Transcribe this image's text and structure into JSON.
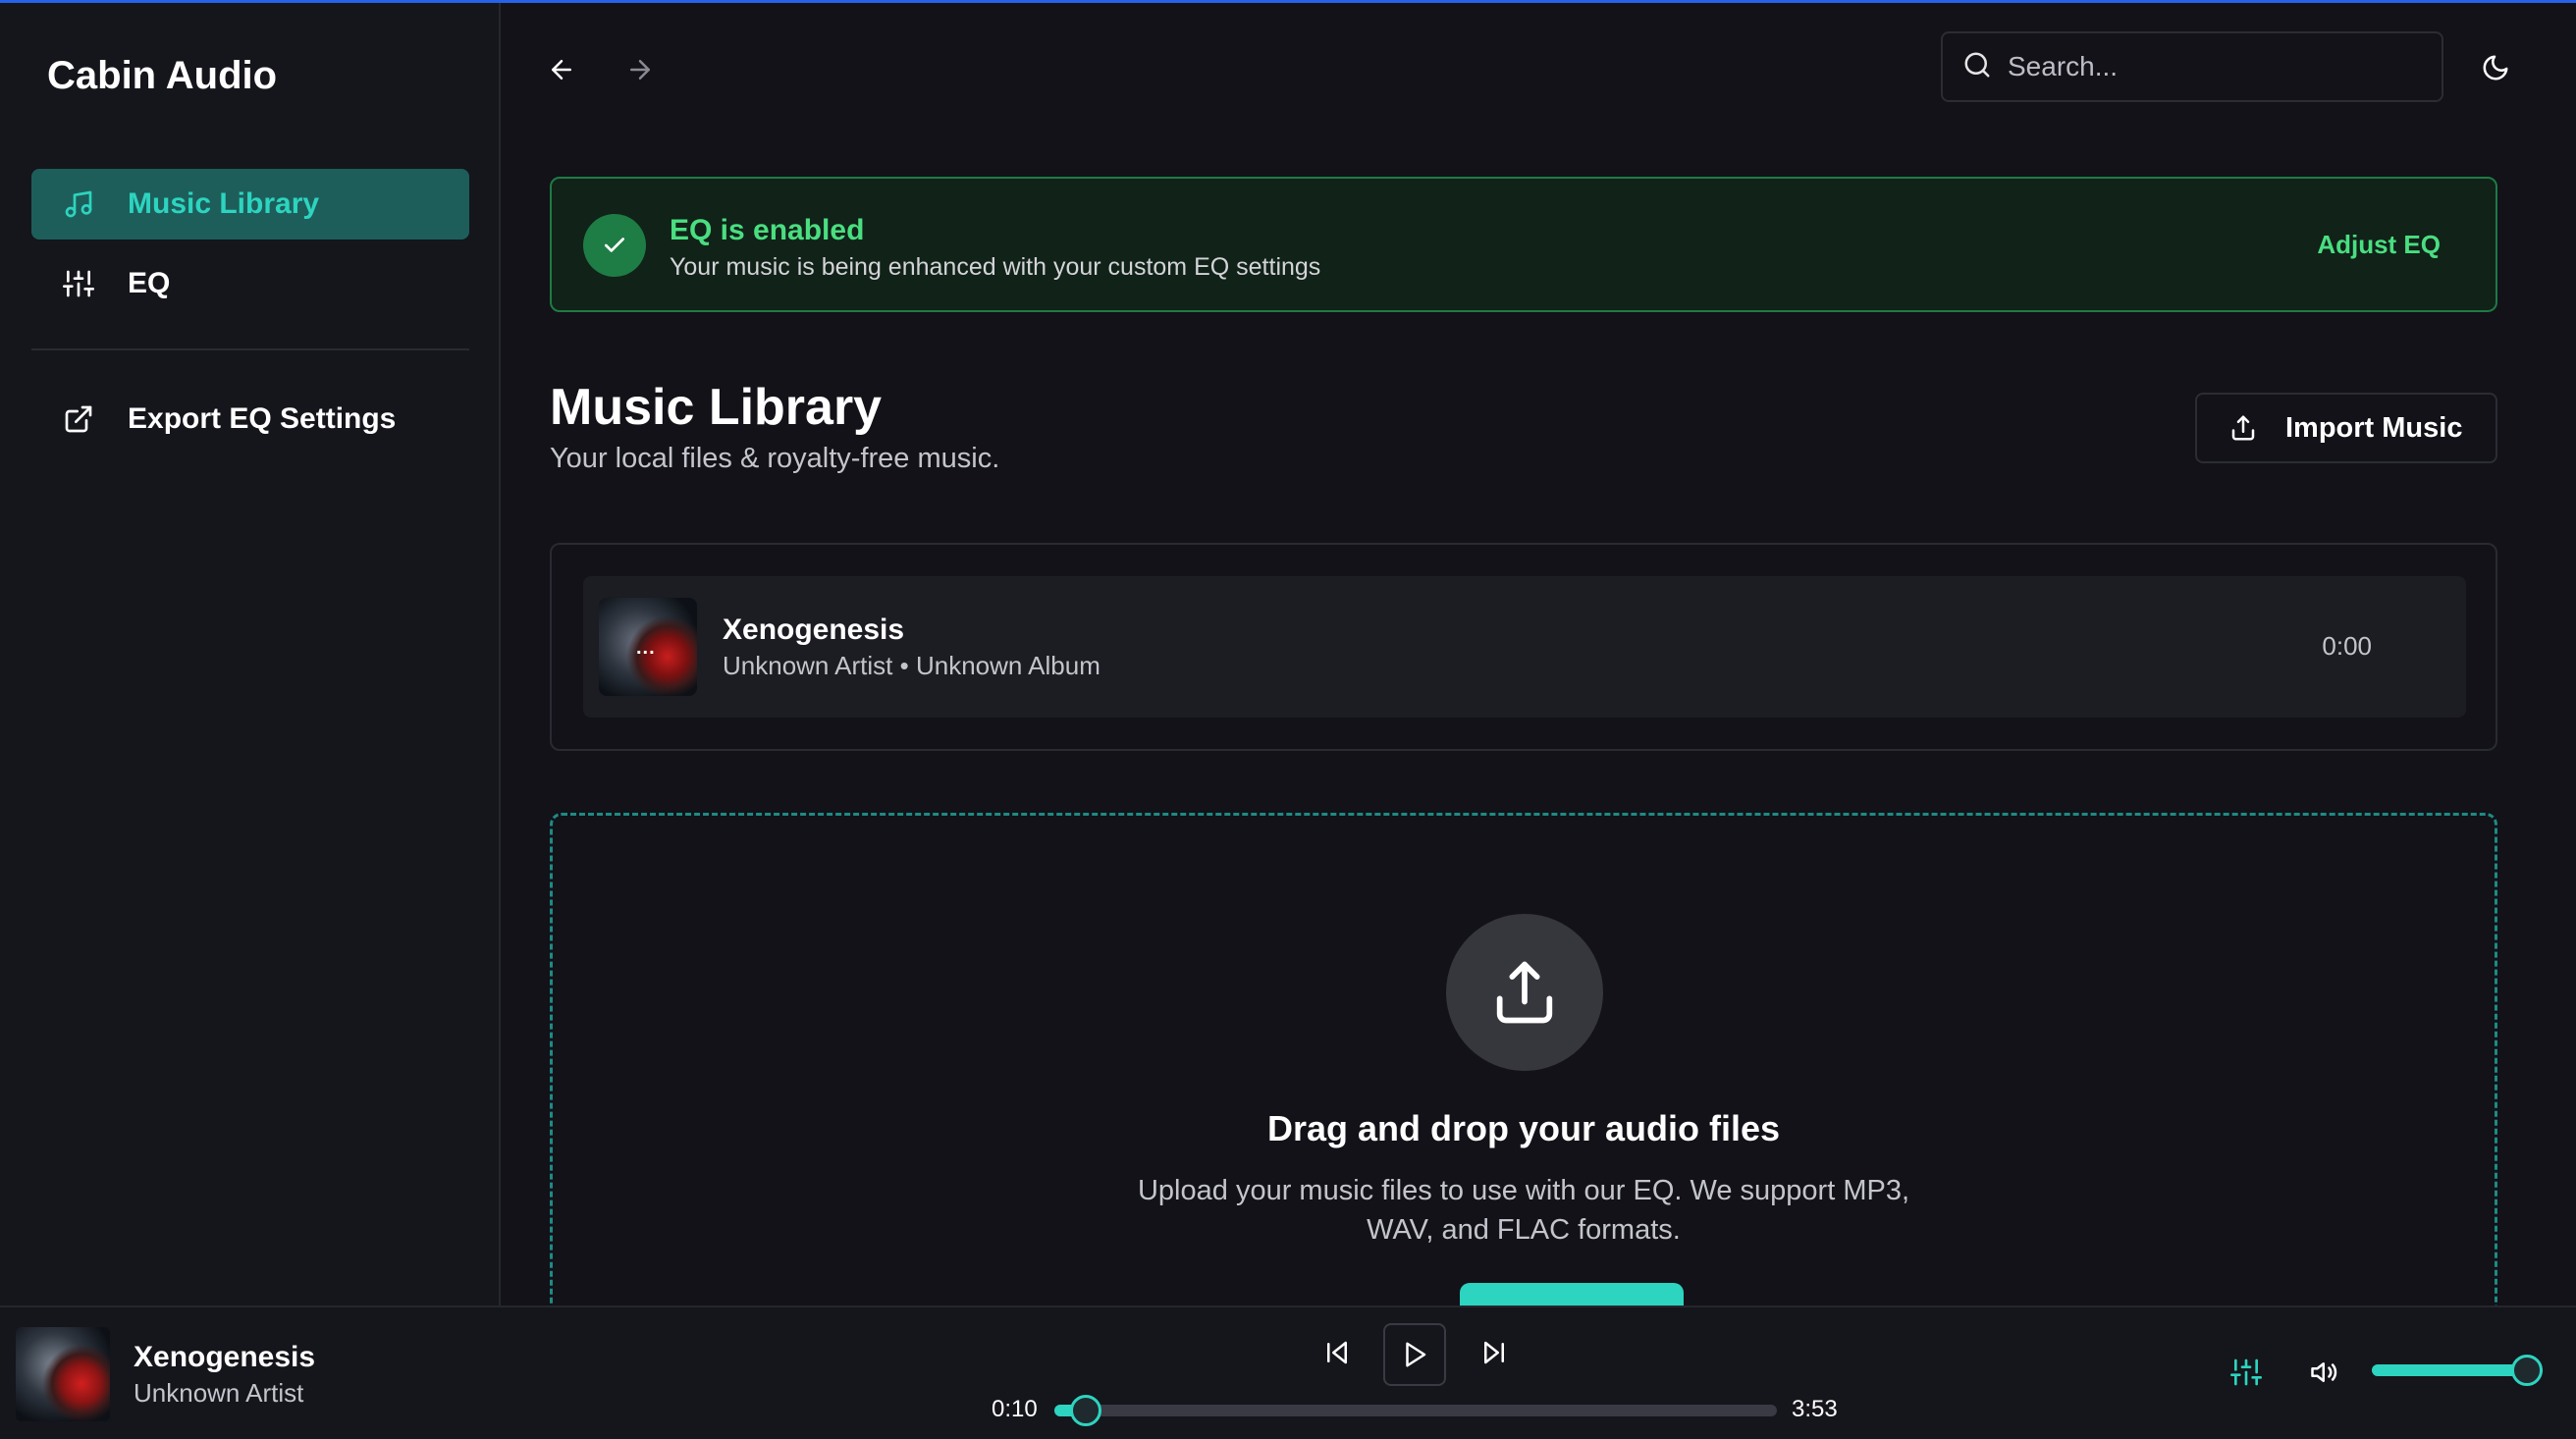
{
  "app": {
    "title": "Cabin Audio"
  },
  "sidebar": {
    "items": [
      {
        "label": "Music Library",
        "icon": "music-note-icon",
        "active": true
      },
      {
        "label": "EQ",
        "icon": "sliders-icon",
        "active": false
      },
      {
        "label": "Export EQ Settings",
        "icon": "external-link-icon",
        "active": false
      }
    ]
  },
  "header": {
    "search_placeholder": "Search...",
    "search_value": ""
  },
  "eq_banner": {
    "title": "EQ is enabled",
    "subtitle": "Your music is being enhanced with your custom EQ settings",
    "action": "Adjust EQ"
  },
  "library": {
    "title": "Music Library",
    "subtitle": "Your local files & royalty-free music.",
    "import_label": "Import Music",
    "tracks": [
      {
        "title": "Xenogenesis",
        "artist": "Unknown Artist",
        "album": "Unknown Album",
        "separator": "•",
        "duration": "0:00",
        "thumb_overlay": "..."
      }
    ]
  },
  "dropzone": {
    "title": "Drag and drop your audio files",
    "subtitle": "Upload your music files to use with our EQ. We support MP3, WAV, and FLAC formats."
  },
  "player": {
    "title": "Xenogenesis",
    "artist": "Unknown Artist",
    "current_time": "0:10",
    "total_time": "3:53",
    "progress_fraction": 0.043,
    "volume_fraction": 1.0
  },
  "colors": {
    "accent": "#2dd4bf",
    "success": "#4ade80",
    "background": "#121218"
  }
}
